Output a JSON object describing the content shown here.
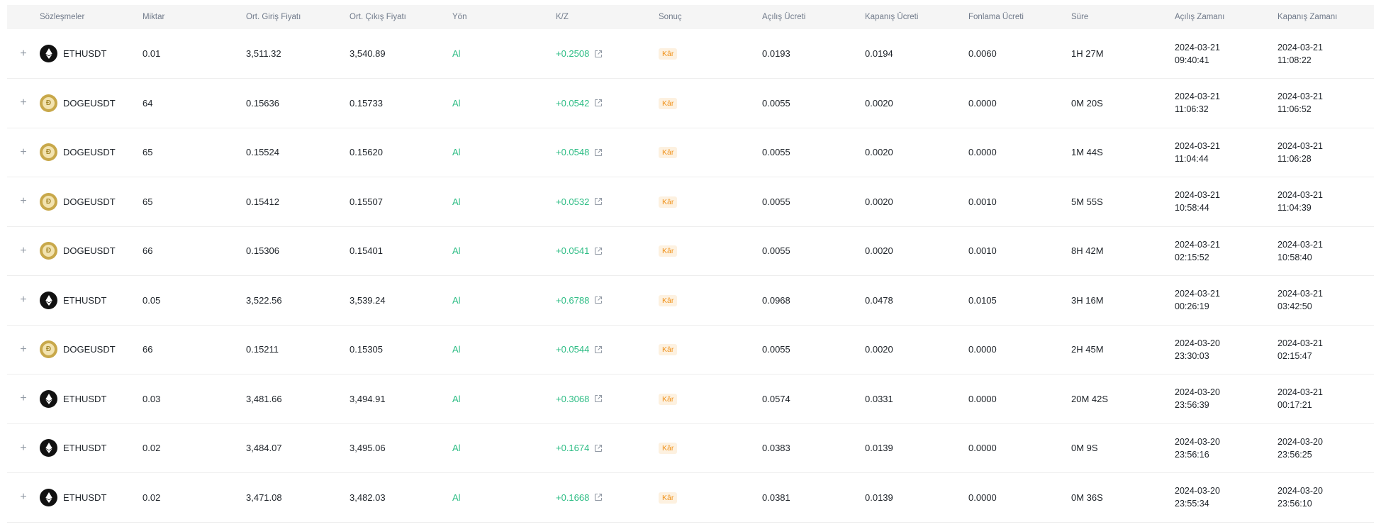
{
  "headers": {
    "contract": "Sözleşmeler",
    "qty": "Miktar",
    "entry": "Ort. Giriş Fiyatı",
    "exit": "Ort. Çıkış Fiyatı",
    "side": "Yön",
    "pnl": "K/Z",
    "result": "Sonuç",
    "open_fee": "Açılış Ücreti",
    "close_fee": "Kapanış Ücreti",
    "funding_fee": "Fonlama Ücreti",
    "duration": "Süre",
    "open_time": "Açılış Zamanı",
    "close_time": "Kapanış Zamanı"
  },
  "expander_glyph": "+",
  "colors": {
    "profit": "#2ebd85",
    "badge_text": "#f0931d",
    "badge_bg": "#fdf1e0"
  },
  "rows": [
    {
      "coin": "eth",
      "symbol": "ETHUSDT",
      "qty": "0.01",
      "entry": "3,511.32",
      "exit": "3,540.89",
      "side": "Al",
      "pnl": "+0.2508",
      "result": "Kâr",
      "open_fee": "0.0193",
      "close_fee": "0.0194",
      "funding_fee": "0.0060",
      "duration": "1H 27M",
      "open_date": "2024-03-21",
      "open_clock": "09:40:41",
      "close_date": "2024-03-21",
      "close_clock": "11:08:22"
    },
    {
      "coin": "doge",
      "symbol": "DOGEUSDT",
      "qty": "64",
      "entry": "0.15636",
      "exit": "0.15733",
      "side": "Al",
      "pnl": "+0.0542",
      "result": "Kâr",
      "open_fee": "0.0055",
      "close_fee": "0.0020",
      "funding_fee": "0.0000",
      "duration": "0M 20S",
      "open_date": "2024-03-21",
      "open_clock": "11:06:32",
      "close_date": "2024-03-21",
      "close_clock": "11:06:52"
    },
    {
      "coin": "doge",
      "symbol": "DOGEUSDT",
      "qty": "65",
      "entry": "0.15524",
      "exit": "0.15620",
      "side": "Al",
      "pnl": "+0.0548",
      "result": "Kâr",
      "open_fee": "0.0055",
      "close_fee": "0.0020",
      "funding_fee": "0.0000",
      "duration": "1M 44S",
      "open_date": "2024-03-21",
      "open_clock": "11:04:44",
      "close_date": "2024-03-21",
      "close_clock": "11:06:28"
    },
    {
      "coin": "doge",
      "symbol": "DOGEUSDT",
      "qty": "65",
      "entry": "0.15412",
      "exit": "0.15507",
      "side": "Al",
      "pnl": "+0.0532",
      "result": "Kâr",
      "open_fee": "0.0055",
      "close_fee": "0.0020",
      "funding_fee": "0.0010",
      "duration": "5M 55S",
      "open_date": "2024-03-21",
      "open_clock": "10:58:44",
      "close_date": "2024-03-21",
      "close_clock": "11:04:39"
    },
    {
      "coin": "doge",
      "symbol": "DOGEUSDT",
      "qty": "66",
      "entry": "0.15306",
      "exit": "0.15401",
      "side": "Al",
      "pnl": "+0.0541",
      "result": "Kâr",
      "open_fee": "0.0055",
      "close_fee": "0.0020",
      "funding_fee": "0.0010",
      "duration": "8H 42M",
      "open_date": "2024-03-21",
      "open_clock": "02:15:52",
      "close_date": "2024-03-21",
      "close_clock": "10:58:40"
    },
    {
      "coin": "eth",
      "symbol": "ETHUSDT",
      "qty": "0.05",
      "entry": "3,522.56",
      "exit": "3,539.24",
      "side": "Al",
      "pnl": "+0.6788",
      "result": "Kâr",
      "open_fee": "0.0968",
      "close_fee": "0.0478",
      "funding_fee": "0.0105",
      "duration": "3H 16M",
      "open_date": "2024-03-21",
      "open_clock": "00:26:19",
      "close_date": "2024-03-21",
      "close_clock": "03:42:50"
    },
    {
      "coin": "doge",
      "symbol": "DOGEUSDT",
      "qty": "66",
      "entry": "0.15211",
      "exit": "0.15305",
      "side": "Al",
      "pnl": "+0.0544",
      "result": "Kâr",
      "open_fee": "0.0055",
      "close_fee": "0.0020",
      "funding_fee": "0.0000",
      "duration": "2H 45M",
      "open_date": "2024-03-20",
      "open_clock": "23:30:03",
      "close_date": "2024-03-21",
      "close_clock": "02:15:47"
    },
    {
      "coin": "eth",
      "symbol": "ETHUSDT",
      "qty": "0.03",
      "entry": "3,481.66",
      "exit": "3,494.91",
      "side": "Al",
      "pnl": "+0.3068",
      "result": "Kâr",
      "open_fee": "0.0574",
      "close_fee": "0.0331",
      "funding_fee": "0.0000",
      "duration": "20M 42S",
      "open_date": "2024-03-20",
      "open_clock": "23:56:39",
      "close_date": "2024-03-21",
      "close_clock": "00:17:21"
    },
    {
      "coin": "eth",
      "symbol": "ETHUSDT",
      "qty": "0.02",
      "entry": "3,484.07",
      "exit": "3,495.06",
      "side": "Al",
      "pnl": "+0.1674",
      "result": "Kâr",
      "open_fee": "0.0383",
      "close_fee": "0.0139",
      "funding_fee": "0.0000",
      "duration": "0M 9S",
      "open_date": "2024-03-20",
      "open_clock": "23:56:16",
      "close_date": "2024-03-20",
      "close_clock": "23:56:25"
    },
    {
      "coin": "eth",
      "symbol": "ETHUSDT",
      "qty": "0.02",
      "entry": "3,471.08",
      "exit": "3,482.03",
      "side": "Al",
      "pnl": "+0.1668",
      "result": "Kâr",
      "open_fee": "0.0381",
      "close_fee": "0.0139",
      "funding_fee": "0.0000",
      "duration": "0M 36S",
      "open_date": "2024-03-20",
      "open_clock": "23:55:34",
      "close_date": "2024-03-20",
      "close_clock": "23:56:10"
    }
  ]
}
